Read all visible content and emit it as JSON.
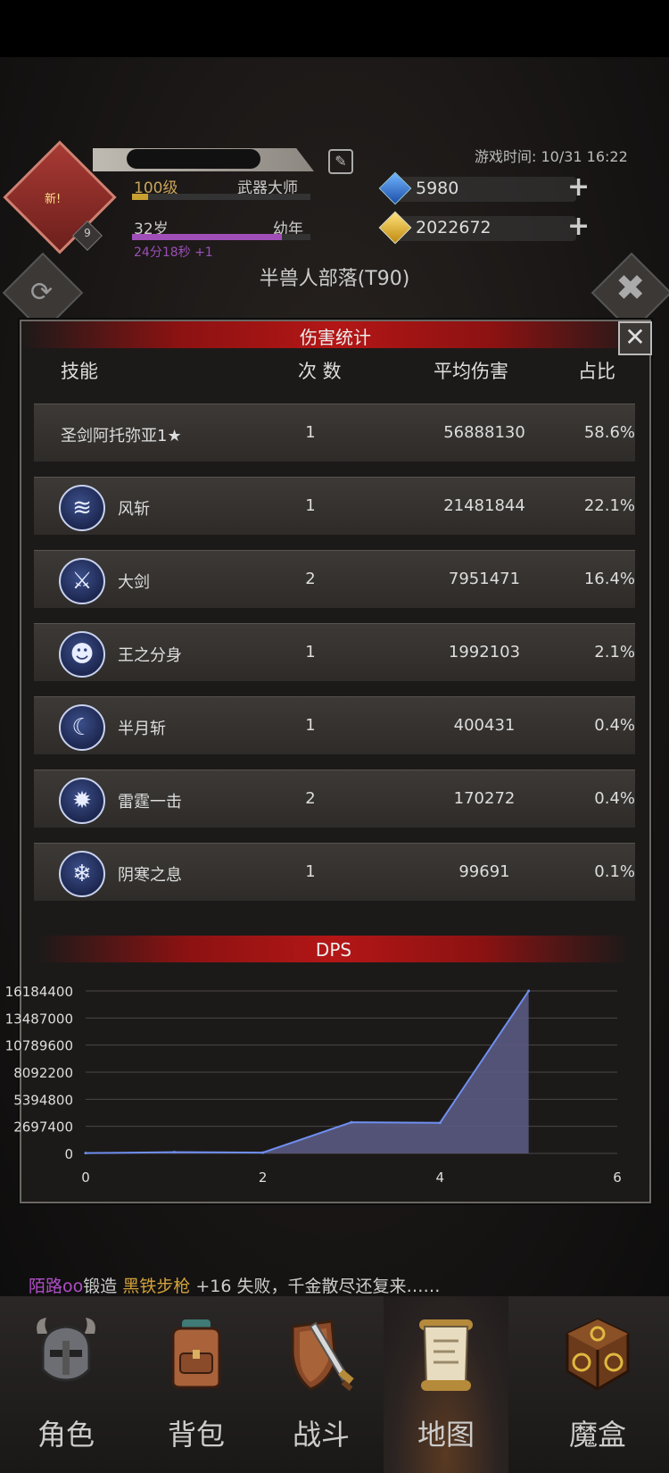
{
  "header": {
    "avatar_badge": "新!",
    "avatar_level": "9",
    "level": "100级",
    "title": "武器大师",
    "age": "32岁",
    "age_stage": "幼年",
    "age_timer": "24分18秒 +1",
    "game_time": "游戏时间: 10/31 16:22",
    "gems": "5980",
    "gold": "2022672",
    "plus": "+",
    "map_name": "半兽人部落(T90)"
  },
  "modal": {
    "title": "伤害统计",
    "close": "✕",
    "columns": {
      "skill": "技能",
      "count": "次 数",
      "avg": "平均伤害",
      "pct": "占比"
    },
    "rows": [
      {
        "name": "圣剑阿托弥亚1★",
        "count": "1",
        "avg": "56888130",
        "pct": "58.6%",
        "icon": ""
      },
      {
        "name": "风斩",
        "count": "1",
        "avg": "21481844",
        "pct": "22.1%",
        "icon": "wind-slash-icon"
      },
      {
        "name": "大剑",
        "count": "2",
        "avg": "7951471",
        "pct": "16.4%",
        "icon": "greatsword-icon"
      },
      {
        "name": "王之分身",
        "count": "1",
        "avg": "1992103",
        "pct": "2.1%",
        "icon": "clone-icon"
      },
      {
        "name": "半月斩",
        "count": "1",
        "avg": "400431",
        "pct": "0.4%",
        "icon": "half-moon-icon"
      },
      {
        "name": "雷霆一击",
        "count": "2",
        "avg": "170272",
        "pct": "0.4%",
        "icon": "thunder-strike-icon"
      },
      {
        "name": "阴寒之息",
        "count": "1",
        "avg": "99691",
        "pct": "0.1%",
        "icon": "frost-breath-icon"
      }
    ]
  },
  "chart_data": {
    "type": "area",
    "title": "DPS",
    "x": [
      0,
      1,
      2,
      3,
      4,
      5
    ],
    "values": [
      30000,
      120000,
      80000,
      3100000,
      3050000,
      16184400
    ],
    "xlim": [
      0,
      6
    ],
    "ylim": [
      0,
      16184400
    ],
    "xticks": [
      0,
      2,
      4,
      6
    ],
    "yticks": [
      0,
      2697400,
      5394800,
      8092200,
      10789600,
      13487000,
      16184400
    ],
    "grid": true,
    "fill_color": "#5a5a82",
    "line_color": "#6f8ff0"
  },
  "ticker": {
    "player": "陌路oo",
    "action": "锻造",
    "item": "黑铁步枪",
    "rest": "+16 失败，千金散尽还复来……"
  },
  "nav": [
    {
      "label": "角色",
      "icon": "helmet-icon"
    },
    {
      "label": "背包",
      "icon": "backpack-icon"
    },
    {
      "label": "战斗",
      "icon": "sword-shield-icon"
    },
    {
      "label": "地图",
      "icon": "scroll-map-icon",
      "active": true
    },
    {
      "label": "魔盒",
      "icon": "magic-box-icon"
    }
  ]
}
